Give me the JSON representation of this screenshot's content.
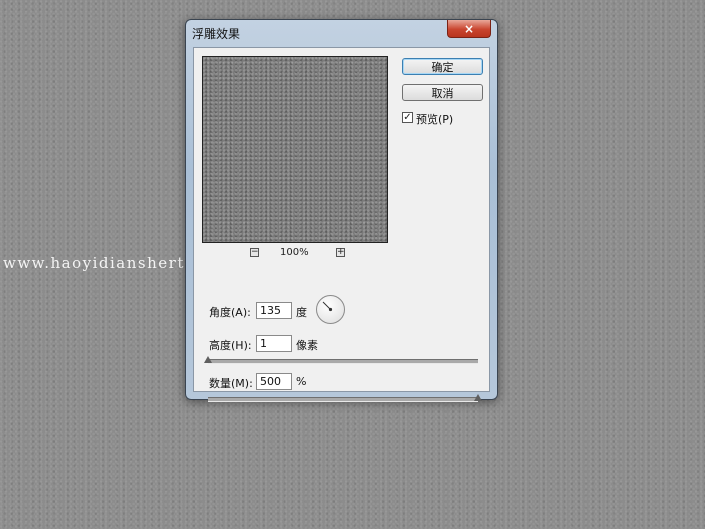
{
  "watermark": "www.haoyidianshert.com",
  "dialog": {
    "title": "浮雕效果",
    "close_icon": "×"
  },
  "preview": {
    "zoom_out_icon": "−",
    "zoom_in_icon": "+",
    "zoom_level": "100%"
  },
  "buttons": {
    "ok": "确定",
    "cancel": "取消"
  },
  "preview_checkbox": {
    "label": "预览(P)",
    "checked": true,
    "check_mark": "✓"
  },
  "angle": {
    "label": "角度(A):",
    "value": "135",
    "unit": "度"
  },
  "height": {
    "label": "高度(H):",
    "value": "1",
    "unit": "像素",
    "slider_level": 0.0
  },
  "amount": {
    "label": "数量(M):",
    "value": "500",
    "unit": "%",
    "slider_level": 1.0
  },
  "colors": {
    "close_button": "#c9452f",
    "ok_button_border": "#3c7fb1",
    "dialog_frame": "#b5c7da"
  }
}
